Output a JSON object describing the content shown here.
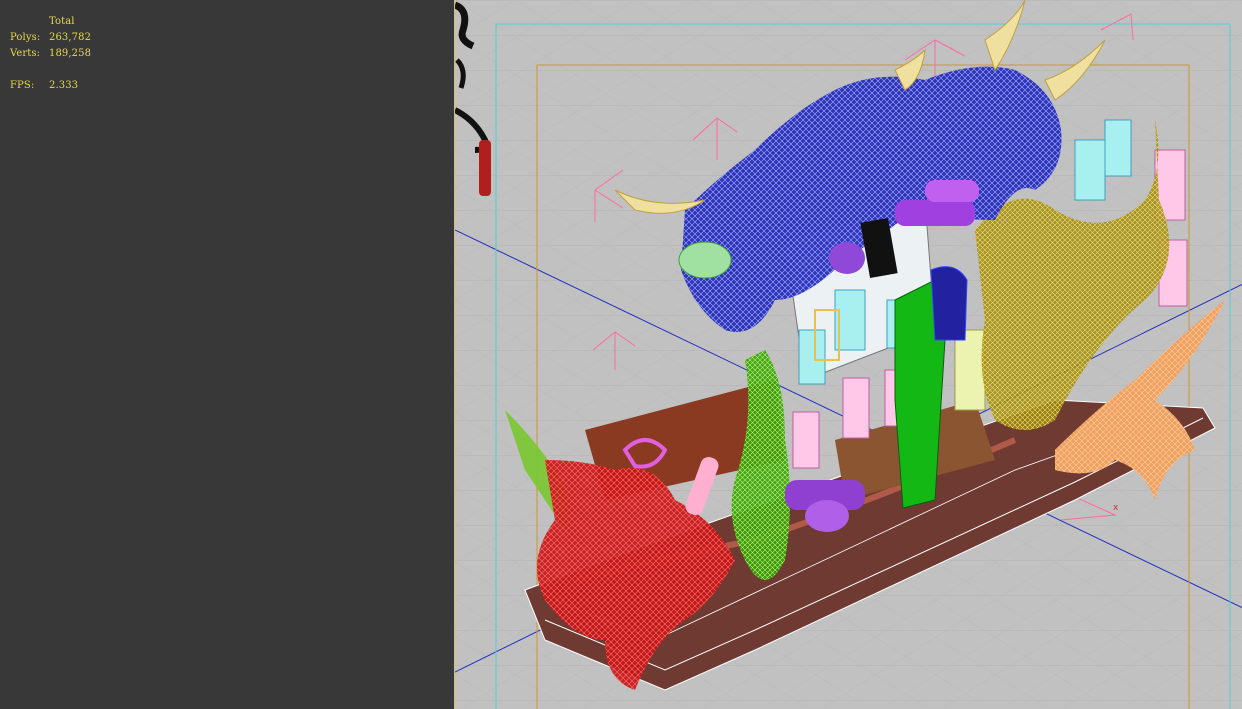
{
  "stats": {
    "header": "Total",
    "polys_label": "Polys:",
    "polys_value": "263,782",
    "verts_label": "Verts:",
    "verts_value": "189,258",
    "fps_label": "FPS:",
    "fps_value": "2.333"
  },
  "viewport": {
    "axis_label": "x",
    "background_color": "#c1c1c1",
    "stats_color": "#e8d84a",
    "safe_frame_outer_color": "#4fd0d8",
    "safe_frame_inner_color": "#c8963c",
    "axis_color": "#2030c0"
  }
}
